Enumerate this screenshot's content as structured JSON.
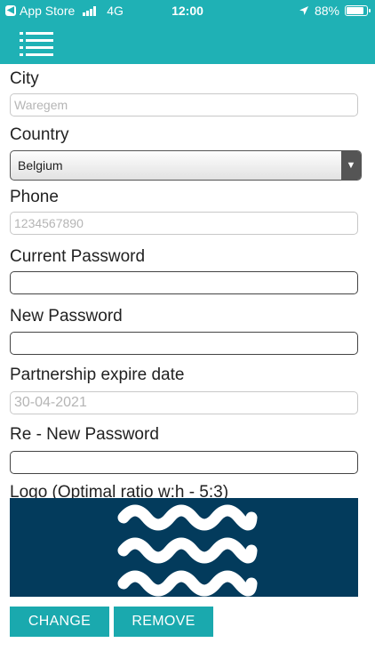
{
  "status_bar": {
    "back_app": "App Store",
    "network": "4G",
    "time": "12:00",
    "battery": "88%",
    "battery_level": 0.88,
    "icons": [
      "back-arrow-icon",
      "signal-icon",
      "location-arrow-icon",
      "battery-icon"
    ]
  },
  "nav": {
    "menu_icon": "hamburger-menu-icon"
  },
  "form": {
    "city_label": "City",
    "city_placeholder": "Waregem",
    "country_label": "Country",
    "country_value": "Belgium",
    "phone_label": "Phone",
    "phone_placeholder": "1234567890",
    "current_password_label": "Current Password",
    "current_password_value": "",
    "new_password_label": "New Password",
    "new_password_value": "",
    "partnership_label": "Partnership expire date",
    "partnership_value": "30-04-2021",
    "re_new_password_label": "Re - New Password",
    "re_new_password_value": "",
    "logo_label": "Logo (Optimal ratio w:h - 5:3)"
  },
  "logo": {
    "background": "#033b5c",
    "wave_color": "#ffffff",
    "icon": "waves-logo-icon"
  },
  "buttons": {
    "change_label": "CHANGE",
    "remove_label": "REMOVE"
  },
  "colors": {
    "accent": "#1fb1b5",
    "button": "#1aa9ae"
  }
}
